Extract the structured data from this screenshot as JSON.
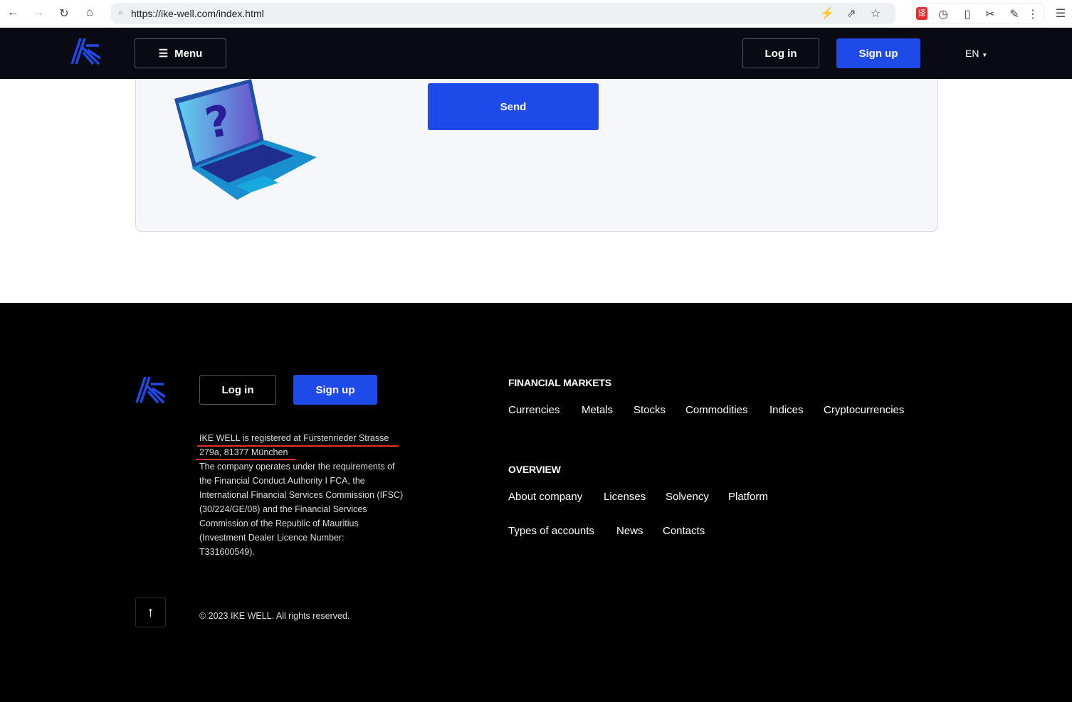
{
  "browser": {
    "url": "https://ike-well.com/index.html"
  },
  "nav": {
    "menu_label": "Menu",
    "login_label": "Log in",
    "signup_label": "Sign up",
    "language": "EN"
  },
  "card": {
    "send_label": "Send"
  },
  "footer": {
    "login_label": "Log in",
    "signup_label": "Sign up",
    "address_line1": "IKE WELL is registered at Fürstenrieder Strasse",
    "address_line2": "279a, 81377 München",
    "legal": [
      "The company operates under the requirements of",
      "the Financial Conduct Authority I FCA, the",
      "International Financial Services Commission (IFSC)",
      "(30/224/GE/08) and the Financial Services",
      "Commission of the Republic of Mauritius",
      "(Investment Dealer Licence Number:",
      "T331600549)."
    ],
    "copyright": "© 2023 IKE WELL. All rights reserved.",
    "financial_markets": {
      "heading": "FINANCIAL MARKETS",
      "links": [
        "Currencies",
        "Metals",
        "Stocks",
        "Commodities",
        "Indices",
        "Cryptocurrencies"
      ]
    },
    "overview": {
      "heading": "OVERVIEW",
      "links": [
        "About company",
        "Licenses",
        "Solvency",
        "Platform",
        "Types of accounts",
        "News",
        "Contacts"
      ]
    }
  },
  "colors": {
    "brand_blue": "#1d4ae8",
    "nav_bg": "#0a0a12",
    "footer_bg": "#000000",
    "underline": "#e53030"
  }
}
